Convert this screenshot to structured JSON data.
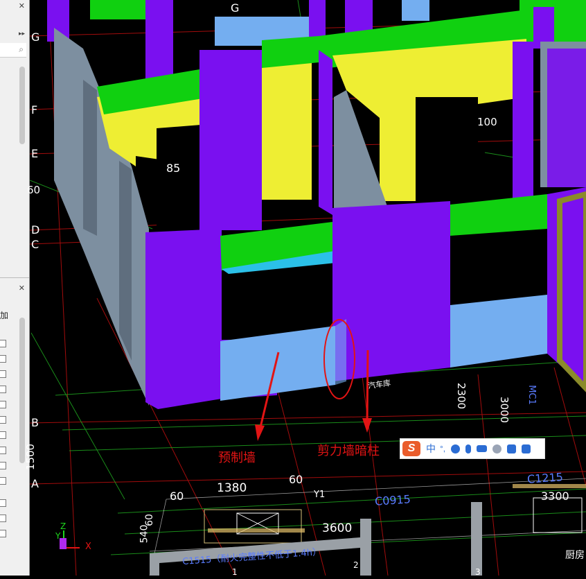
{
  "left_panel": {
    "row_text": "加"
  },
  "annotations": {
    "precast_wall": "预制墙",
    "shear_wall_column": "剪力墙暗柱",
    "garage": "汽车库"
  },
  "grid_labels": [
    "G",
    "F",
    "E",
    "D",
    "C",
    "B",
    "A"
  ],
  "top_grid_label": "G",
  "left_dims": [
    "60",
    "1500"
  ],
  "dims": {
    "d85": "85",
    "d100": "100",
    "d1380": "1380",
    "d60a": "60",
    "d60b": "60",
    "d3600": "3600",
    "d3300": "3300",
    "d2300": "2300",
    "d3000": "3000",
    "d540": "540",
    "d60c": "60",
    "dim_y1": "Y1"
  },
  "window_tags": {
    "c0915": "C0915",
    "c1215": "C1215",
    "c1515": "C1515（耐火完整性不低于1.4h）",
    "mc": "MC1"
  },
  "room_labels": {
    "kitchen": "厨房",
    "room1": "1",
    "room2": "2",
    "room3": "3"
  },
  "axis": {
    "x": "X",
    "y": "Y",
    "z": "Z"
  },
  "ime": {
    "logo": "S",
    "lang": "中",
    "punct": "°,"
  },
  "colors": {
    "wall": "#7a10f0",
    "yellow": "#eeee33",
    "green": "#10d010",
    "lightblue": "#74aef0",
    "gray": "#7d8fa0",
    "red": "#e21414"
  }
}
